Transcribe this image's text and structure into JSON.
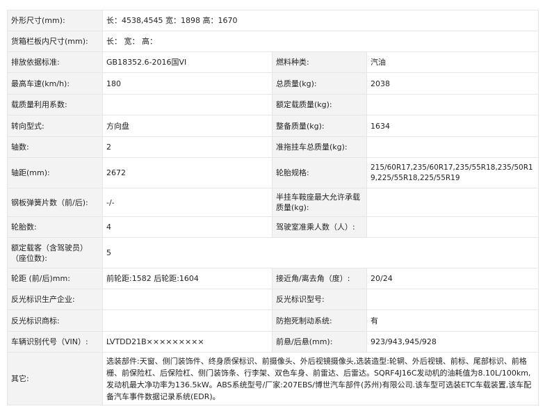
{
  "rows": [
    {
      "label": "外形尺寸(mm):",
      "value": "长：4538,4545 宽：1898 高：1670"
    },
    {
      "label": "货箱栏板内尺寸(mm):",
      "value": "长： 宽： 高："
    },
    {
      "label": "排放依据标准:",
      "value": "GB18352.6-2016国VI",
      "label2": "燃料种类:",
      "value2": "汽油"
    },
    {
      "label": "最高车速(km/h):",
      "value": "180",
      "label2": "总质量(kg):",
      "value2": "2038"
    },
    {
      "label": "载质量利用系数:",
      "value": "",
      "label2": "额定载质量(kg):",
      "value2": ""
    },
    {
      "label": "转向型式:",
      "value": "方向盘",
      "label2": "整备质量(kg):",
      "value2": "1634"
    },
    {
      "label": "轴数:",
      "value": "2",
      "label2": "准拖挂车总质量(kg):",
      "value2": ""
    },
    {
      "label": "轴距(mm):",
      "value": "2672",
      "label2": "轮胎规格:",
      "value2": "215/60R17,235/60R17,235/55R18,235/50R19,225/55R18,225/55R19"
    },
    {
      "label": "钢板弹簧片数（前/后):",
      "value": "-/-",
      "label2": "半挂车鞍座最大允许承载质量(kg):",
      "value2": ""
    },
    {
      "label": "轮胎数:",
      "value": "4",
      "label2": "驾驶室准乘人数（人）:",
      "value2": ""
    },
    {
      "label": "额定载客（含驾驶员）（座位数):",
      "value": "5"
    },
    {
      "label": "轮距 (前/后)mm:",
      "value": "前轮距:1582 后轮距:1604",
      "label2": "接近角/离去角（度）:",
      "value2": "20/24"
    },
    {
      "label": "反光标识生产企业:",
      "value": "",
      "label2": "反光标识型号:",
      "value2": ""
    },
    {
      "label": "反光标识商标:",
      "value": "",
      "label2": "防抱死制动系统:",
      "value2": "有"
    },
    {
      "label": "车辆识别代号（VIN）:",
      "value": "LVTDD21B×××××××××",
      "label2": "前悬/后悬(mm):",
      "value2": "923/943,945/928"
    },
    {
      "label": "其它:",
      "value": "选装部件:天窗、侧门装饰件、终身质保标识、前摄像头、外后视镜摄像头,选装造型:轮辋、外后视镜、前标、尾部标识、前格栅、前保险杠、后保险杠、侧门装饰条、行李架、双色车身、前雷达、后雷达。SQRF4J16C发动机的油耗值为8.10L/100km,发动机最大净功率为136.5kW。ABS系统型号/厂家:207EBS/博世汽车部件(苏州)有限公司.该车型可选装ETC车载装置,该车配备汽车事件数据记录系统(EDR)。"
    }
  ]
}
